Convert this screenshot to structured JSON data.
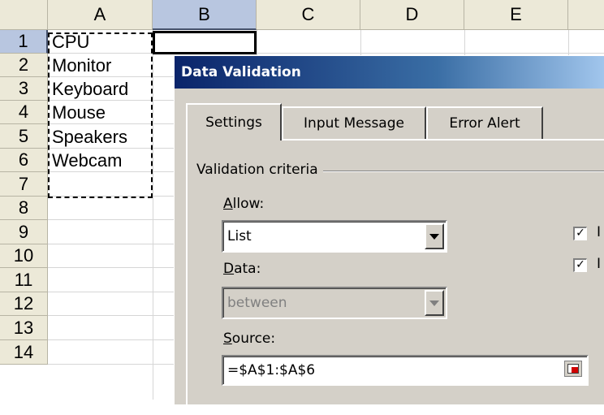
{
  "sheet": {
    "columns": [
      "A",
      "B",
      "C",
      "D",
      "E"
    ],
    "rows": [
      "1",
      "2",
      "3",
      "4",
      "5",
      "6",
      "7",
      "8",
      "9",
      "10",
      "11",
      "12",
      "13",
      "14"
    ],
    "cells_a": [
      "CPU",
      "Monitor",
      "Keyboard",
      "Mouse",
      "Speakers",
      "Webcam"
    ],
    "selected_column": "B",
    "selected_row": "1"
  },
  "dialog": {
    "title": "Data Validation",
    "tabs": [
      "Settings",
      "Input Message",
      "Error Alert"
    ],
    "active_tab": "Settings",
    "group_label": "Validation criteria",
    "allow": {
      "label_accel": "A",
      "label_rest": "llow:",
      "value": "List"
    },
    "data": {
      "label_accel": "D",
      "label_rest": "ata:",
      "value": "between",
      "disabled": true
    },
    "source": {
      "label_accel": "S",
      "label_rest": "ource:",
      "value": "=$A$1:$A$6"
    },
    "checkboxes": [
      {
        "label": "I",
        "checked": true
      },
      {
        "label": "I",
        "checked": true
      }
    ]
  },
  "icons": {
    "check": "checkmark-icon",
    "dropdown": "chevron-down-icon",
    "range": "collapse-range-icon"
  },
  "colors": {
    "title_start": "#0a246a",
    "title_end": "#a6caf0",
    "dialog_bg": "#d4d0c8",
    "header_bg": "#ece9d8"
  }
}
